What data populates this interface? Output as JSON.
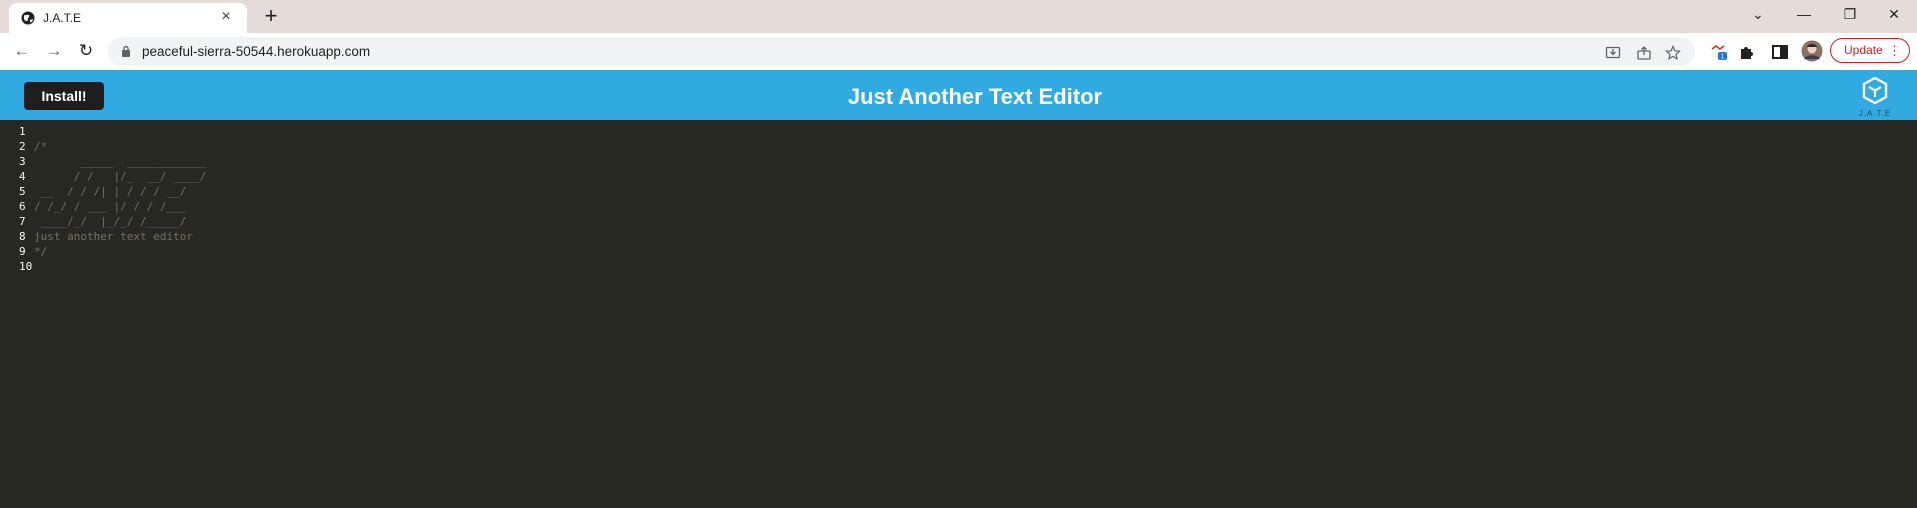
{
  "browser": {
    "tab": {
      "title": "J.A.T.E",
      "favicon": "globe-icon",
      "close_icon": "×"
    },
    "new_tab_icon": "+",
    "window_controls": {
      "chevron": "⌄",
      "minimize": "—",
      "restore": "❐",
      "close": "✕"
    },
    "nav": {
      "back": "←",
      "forward": "→",
      "reload": "↻"
    },
    "url": "peaceful-sierra-50544.herokuapp.com",
    "extension_badge_count": "1",
    "update_label": "Update",
    "menu_dots": "⋮",
    "colors": {
      "tabstrip": "#e5dcd9",
      "update_accent": "#c5221f"
    }
  },
  "app": {
    "install_label": "Install!",
    "title": "Just Another Text Editor",
    "logo_text": "J.A.T.E",
    "colors": {
      "header": "#31a9e1",
      "editor_bg": "#272822",
      "comment": "#75715e"
    }
  },
  "editor": {
    "line_numbers": [
      "1",
      "2",
      "3",
      "4",
      "5",
      "6",
      "7",
      "8",
      "9",
      "10"
    ],
    "lines": [
      "",
      "/*",
      "       _____  ____________",
      "      / /   |/_  __/ ____/",
      " __  / / /| | / / / __/",
      "/ /_/ / ___ |/ / / /___",
      " ____/_/  |_/_/ /_____/",
      "just another text editor",
      "*/",
      ""
    ]
  }
}
